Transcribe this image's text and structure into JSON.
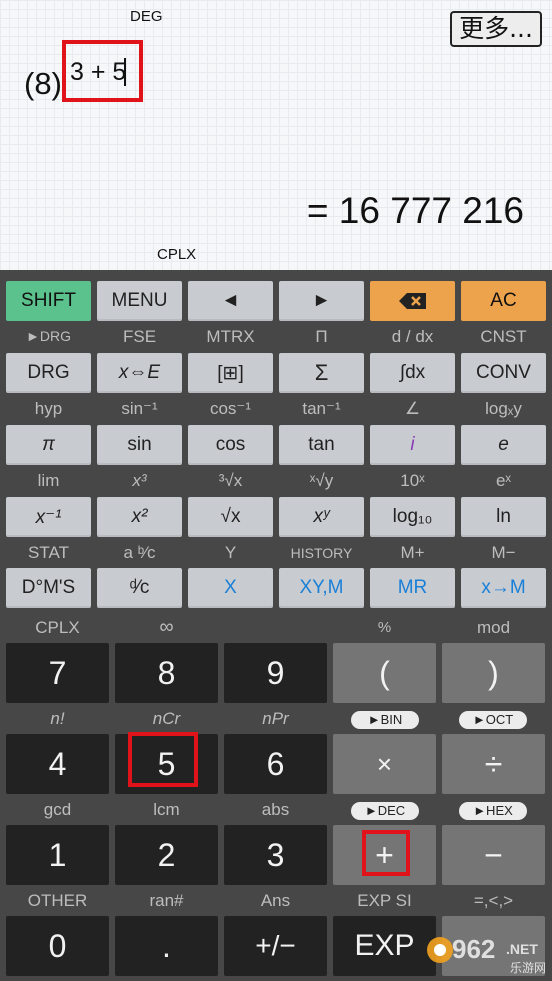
{
  "display": {
    "angle_mode": "DEG",
    "complex_mode": "CPLX",
    "more_button": "更多...",
    "base_indicator": "(8)",
    "expression": "3 + 5",
    "result": "= 16 777 216"
  },
  "top_keys": {
    "shift": "SHIFT",
    "menu": "MENU",
    "left": "◄",
    "right": "►",
    "backspace": "⌫",
    "ac": "AC"
  },
  "labels_r1": [
    "►DRG",
    "FSE",
    "MTRX",
    "Π",
    "d / dx",
    "CNST"
  ],
  "keys_r1": [
    "DRG",
    "x⇔E",
    "[⊞]",
    "Σ",
    "∫dx",
    "CONV"
  ],
  "labels_r2": [
    "hyp",
    "sin⁻¹",
    "cos⁻¹",
    "tan⁻¹",
    "∠",
    "logₓy"
  ],
  "keys_r2": [
    "π",
    "sin",
    "cos",
    "tan",
    "i",
    "e"
  ],
  "labels_r3": [
    "lim",
    "x³",
    "³√x",
    "ˣ√y",
    "10ˣ",
    "eˣ"
  ],
  "keys_r3": [
    "x⁻¹",
    "x²",
    "√x",
    "xʸ",
    "log₁₀",
    "ln"
  ],
  "labels_r4": [
    "STAT",
    "a ᵇ⁄c",
    "Y",
    "HISTORY",
    "M+",
    "M−"
  ],
  "keys_r4": [
    "D°M'S",
    "ᵈ⁄c",
    "X",
    "XY,M",
    "MR",
    "x→M"
  ],
  "labels_r5": [
    "CPLX",
    "∞",
    "",
    "%",
    "mod"
  ],
  "keys_r5": [
    "7",
    "8",
    "9",
    "(",
    ")"
  ],
  "labels_r6": [
    "n!",
    "nCr",
    "nPr"
  ],
  "pills_r6": [
    "►BIN",
    "►OCT"
  ],
  "keys_r6": [
    "4",
    "5",
    "6",
    "×",
    "÷"
  ],
  "labels_r7": [
    "gcd",
    "lcm",
    "abs"
  ],
  "pills_r7": [
    "►DEC",
    "►HEX"
  ],
  "keys_r7": [
    "1",
    "2",
    "3",
    "+",
    "−"
  ],
  "labels_r8": [
    "OTHER",
    "ran#",
    "Ans",
    "EXP SI",
    "=,<,>"
  ],
  "keys_r8": [
    "0",
    ".",
    "+/−",
    "EXP",
    ""
  ],
  "watermark": {
    "text": "962",
    "suffix": ".NET",
    "sub": "乐游网"
  },
  "colors": {
    "shift": "#5cc28d",
    "accent": "#eda34b",
    "highlight": "#e0121a",
    "link_blue": "#1a7fd6"
  }
}
